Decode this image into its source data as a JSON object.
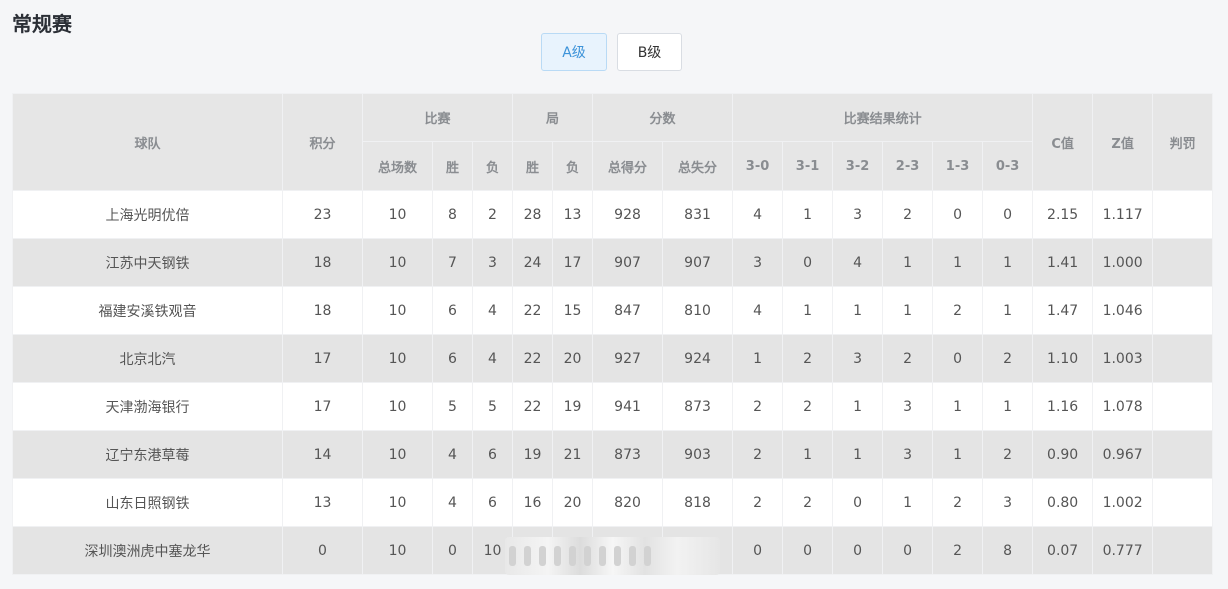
{
  "page_title": "常规赛",
  "tabs": [
    {
      "label": "A级",
      "active": true
    },
    {
      "label": "B级",
      "active": false
    }
  ],
  "table": {
    "group_headers": {
      "team": "球队",
      "points": "积分",
      "matches": "比赛",
      "sets": "局",
      "score": "分数",
      "result_stats": "比赛结果统计",
      "c_value": "C值",
      "z_value": "Z值",
      "penalty": "判罚"
    },
    "sub_headers": {
      "total_matches": "总场数",
      "win": "胜",
      "loss": "负",
      "set_win": "胜",
      "set_loss": "负",
      "points_for": "总得分",
      "points_against": "总失分",
      "r30": "3-0",
      "r31": "3-1",
      "r32": "3-2",
      "r23": "2-3",
      "r13": "1-3",
      "r03": "0-3"
    },
    "rows": [
      {
        "team": "上海光明优倍",
        "points": "23",
        "total": "10",
        "w": "8",
        "l": "2",
        "sw": "28",
        "sl": "13",
        "pf": "928",
        "pa": "831",
        "r30": "4",
        "r31": "1",
        "r32": "3",
        "r23": "2",
        "r13": "0",
        "r03": "0",
        "c": "2.15",
        "z": "1.117",
        "penalty": ""
      },
      {
        "team": "江苏中天钢铁",
        "points": "18",
        "total": "10",
        "w": "7",
        "l": "3",
        "sw": "24",
        "sl": "17",
        "pf": "907",
        "pa": "907",
        "r30": "3",
        "r31": "0",
        "r32": "4",
        "r23": "1",
        "r13": "1",
        "r03": "1",
        "c": "1.41",
        "z": "1.000",
        "penalty": ""
      },
      {
        "team": "福建安溪铁观音",
        "points": "18",
        "total": "10",
        "w": "6",
        "l": "4",
        "sw": "22",
        "sl": "15",
        "pf": "847",
        "pa": "810",
        "r30": "4",
        "r31": "1",
        "r32": "1",
        "r23": "1",
        "r13": "2",
        "r03": "1",
        "c": "1.47",
        "z": "1.046",
        "penalty": ""
      },
      {
        "team": "北京北汽",
        "points": "17",
        "total": "10",
        "w": "6",
        "l": "4",
        "sw": "22",
        "sl": "20",
        "pf": "927",
        "pa": "924",
        "r30": "1",
        "r31": "2",
        "r32": "3",
        "r23": "2",
        "r13": "0",
        "r03": "2",
        "c": "1.10",
        "z": "1.003",
        "penalty": ""
      },
      {
        "team": "天津渤海银行",
        "points": "17",
        "total": "10",
        "w": "5",
        "l": "5",
        "sw": "22",
        "sl": "19",
        "pf": "941",
        "pa": "873",
        "r30": "2",
        "r31": "2",
        "r32": "1",
        "r23": "3",
        "r13": "1",
        "r03": "1",
        "c": "1.16",
        "z": "1.078",
        "penalty": ""
      },
      {
        "team": "辽宁东港草莓",
        "points": "14",
        "total": "10",
        "w": "4",
        "l": "6",
        "sw": "19",
        "sl": "21",
        "pf": "873",
        "pa": "903",
        "r30": "2",
        "r31": "1",
        "r32": "1",
        "r23": "3",
        "r13": "1",
        "r03": "2",
        "c": "0.90",
        "z": "0.967",
        "penalty": ""
      },
      {
        "team": "山东日照钢铁",
        "points": "13",
        "total": "10",
        "w": "4",
        "l": "6",
        "sw": "16",
        "sl": "20",
        "pf": "820",
        "pa": "818",
        "r30": "2",
        "r31": "2",
        "r32": "0",
        "r23": "1",
        "r13": "2",
        "r03": "3",
        "c": "0.80",
        "z": "1.002",
        "penalty": ""
      },
      {
        "team": "深圳澳洲虎中塞龙华",
        "points": "0",
        "total": "10",
        "w": "0",
        "l": "10",
        "sw": "",
        "sl": "",
        "pf": "",
        "pa": "",
        "r30": "0",
        "r31": "0",
        "r32": "0",
        "r23": "0",
        "r13": "2",
        "r03": "8",
        "c": "0.07",
        "z": "0.777",
        "penalty": ""
      }
    ]
  }
}
